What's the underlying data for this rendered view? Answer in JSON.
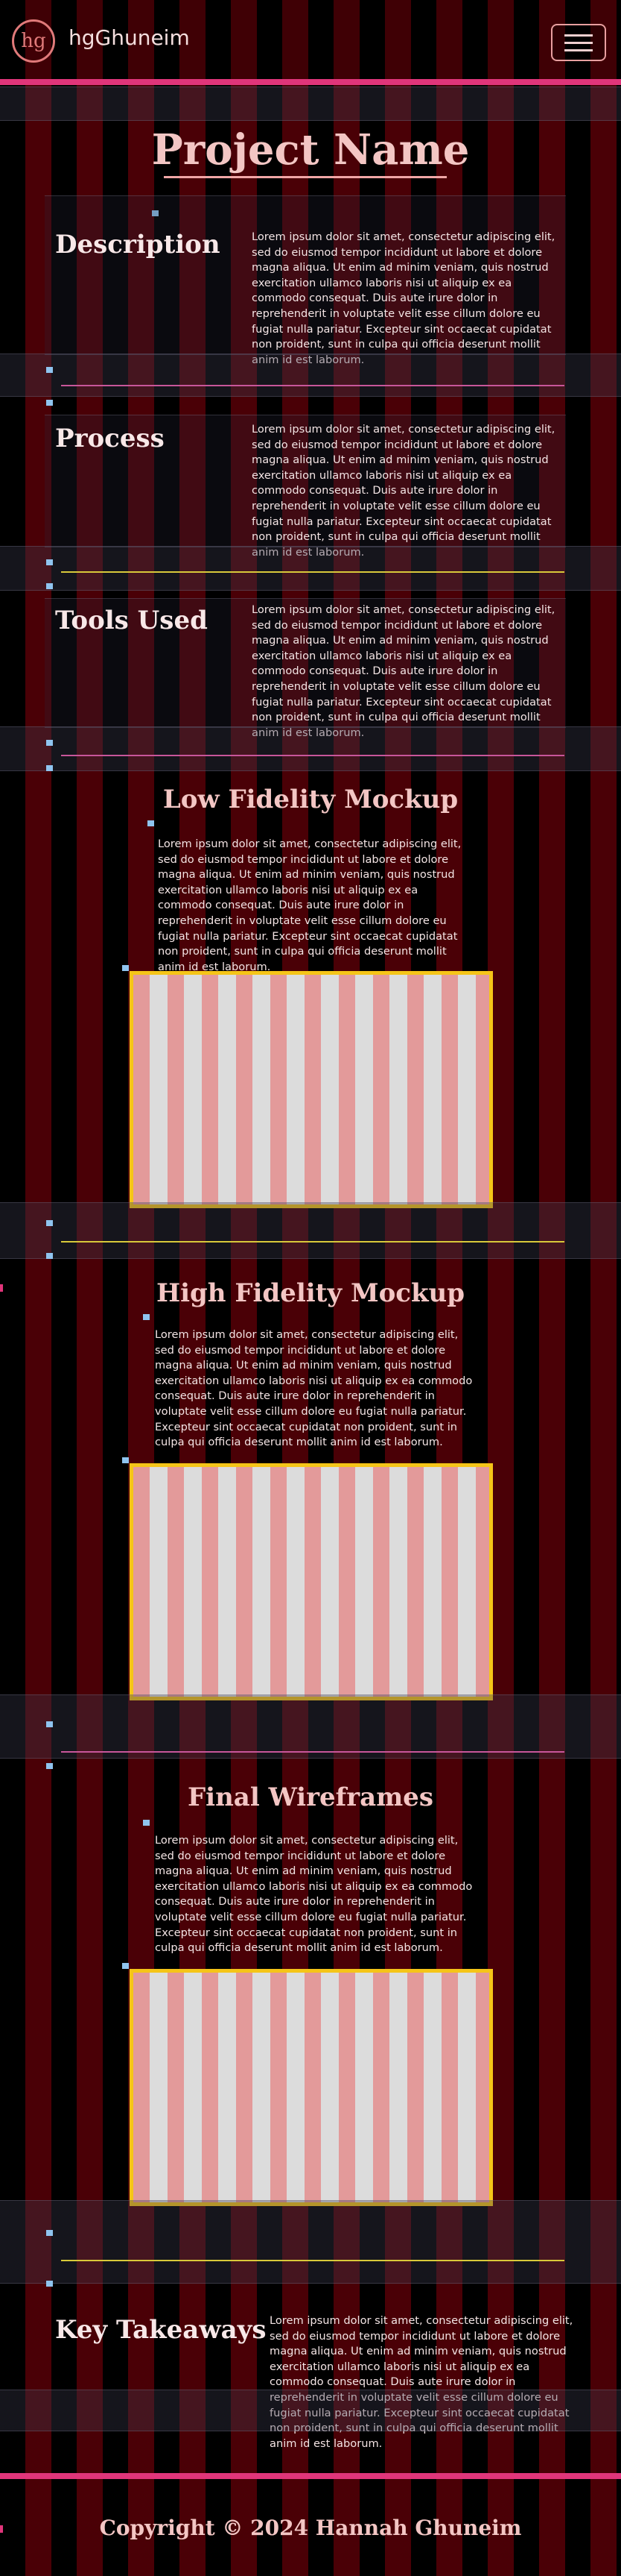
{
  "header": {
    "logo_text": "hg",
    "brand": "hgGhuneim",
    "menu_icon": "hamburger-icon"
  },
  "project": {
    "title": "Project Name"
  },
  "lorem": "Lorem ipsum dolor sit amet, consectetur adipiscing elit, sed do eiusmod tempor incididunt ut labore et dolore magna aliqua. Ut enim ad minim veniam, quis nostrud exercitation ullamco laboris nisi ut aliquip ex ea commodo consequat. Duis aute irure dolor in reprehenderit in voluptate velit esse cillum dolore eu fugiat nulla pariatur. Excepteur sint occaecat cupidatat non proident, sunt in culpa qui officia deserunt mollit anim id est laborum.",
  "sections": {
    "description": {
      "title": "Description",
      "text": "Lorem ipsum dolor sit amet, consectetur adipiscing elit, sed do eiusmod tempor incididunt ut labore et dolore magna aliqua. Ut enim ad minim veniam, quis nostrud exercitation ullamco laboris nisi ut aliquip ex ea commodo consequat. Duis aute irure dolor in reprehenderit in voluptate velit esse cillum dolore eu fugiat nulla pariatur. Excepteur sint occaecat cupidatat non proident, sunt in culpa qui officia deserunt mollit anim id est laborum."
    },
    "process": {
      "title": "Process",
      "text": "Lorem ipsum dolor sit amet, consectetur adipiscing elit, sed do eiusmod tempor incididunt ut labore et dolore magna aliqua. Ut enim ad minim veniam, quis nostrud exercitation ullamco laboris nisi ut aliquip ex ea commodo consequat. Duis aute irure dolor in reprehenderit in voluptate velit esse cillum dolore eu fugiat nulla pariatur. Excepteur sint occaecat cupidatat non proident, sunt in culpa qui officia deserunt mollit anim id est laborum."
    },
    "tools": {
      "title": "Tools Used",
      "text": "Lorem ipsum dolor sit amet, consectetur adipiscing elit, sed do eiusmod tempor incididunt ut labore et dolore magna aliqua. Ut enim ad minim veniam, quis nostrud exercitation ullamco laboris nisi ut aliquip ex ea commodo consequat. Duis aute irure dolor in reprehenderit in voluptate velit esse cillum dolore eu fugiat nulla pariatur. Excepteur sint occaecat cupidatat non proident, sunt in culpa qui officia deserunt mollit anim id est laborum."
    },
    "low_fi": {
      "title": "Low Fidelity Mockup",
      "text": "Lorem ipsum dolor sit amet, consectetur adipiscing elit, sed do eiusmod tempor incididunt ut labore et dolore magna aliqua. Ut enim ad minim veniam, quis nostrud exercitation ullamco laboris nisi ut aliquip ex ea commodo consequat. Duis aute irure dolor in reprehenderit in voluptate velit esse cillum dolore eu fugiat nulla pariatur. Excepteur sint occaecat cupidatat non proident, sunt in culpa qui officia deserunt mollit anim id est laborum."
    },
    "high_fi": {
      "title": "High Fidelity Mockup",
      "text": "Lorem ipsum dolor sit amet, consectetur adipiscing elit, sed do eiusmod tempor incididunt ut labore et dolore magna aliqua. Ut enim ad minim veniam, quis nostrud exercitation ullamco laboris nisi ut aliquip ex ea commodo consequat. Duis aute irure dolor in reprehenderit in voluptate velit esse cillum dolore eu fugiat nulla pariatur. Excepteur sint occaecat cupidatat non proident, sunt in culpa qui officia deserunt mollit anim id est laborum."
    },
    "wireframes": {
      "title": "Final Wireframes",
      "text": "Lorem ipsum dolor sit amet, consectetur adipiscing elit, sed do eiusmod tempor incididunt ut labore et dolore magna aliqua. Ut enim ad minim veniam, quis nostrud exercitation ullamco laboris nisi ut aliquip ex ea commodo consequat. Duis aute irure dolor in reprehenderit in voluptate velit esse cillum dolore eu fugiat nulla pariatur. Excepteur sint occaecat cupidatat non proident, sunt in culpa qui officia deserunt mollit anim id est laborum."
    },
    "takeaways": {
      "title": "Key Takeaways",
      "text": "Lorem ipsum dolor sit amet, consectetur adipiscing elit, sed do eiusmod tempor incididunt ut labore et dolore magna aliqua. Ut enim ad minim veniam, quis nostrud exercitation ullamco laboris nisi ut aliquip ex ea commodo consequat. Duis aute irure dolor in reprehenderit in voluptate velit esse cillum dolore eu fugiat nulla pariatur. Excepteur sint occaecat cupidatat non proident, sunt in culpa qui officia deserunt mollit anim id est laborum."
    }
  },
  "footer": {
    "copyright": "Copyright © 2024 Hannah Ghuneim"
  },
  "colors": {
    "accent_pink": "#e0357a",
    "title_pink": "#f3c6c4",
    "mockup_border": "#f5c518",
    "stripe_red": "#4a0006"
  }
}
